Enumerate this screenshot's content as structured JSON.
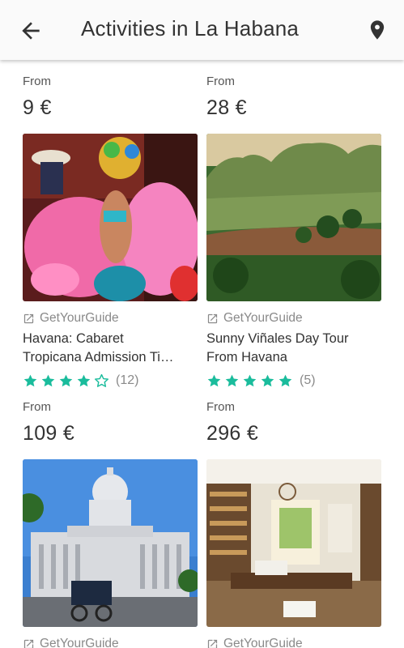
{
  "header": {
    "title": "Activities in La Habana",
    "back_icon": "arrow-back-icon",
    "location_icon": "location-pin-icon"
  },
  "colors": {
    "accent": "#1ABC9C",
    "text": "#333333",
    "muted": "#8A8A8A"
  },
  "activities": [
    {
      "from_label": "From",
      "price": "9 €",
      "provider": "GetYourGuide",
      "name_line1": "Havana: Cabaret",
      "name_line2": "Tropicana Admission Ti…",
      "stars": 4,
      "reviews": "(12)"
    },
    {
      "from_label": "From",
      "price": "28 €",
      "provider": "GetYourGuide",
      "name_line1": "Sunny Viñales Day Tour",
      "name_line2": "From Havana",
      "stars": 5,
      "reviews": "(5)"
    },
    {
      "from_label": "From",
      "price": "109 €",
      "provider": "GetYourGuide"
    },
    {
      "from_label": "From",
      "price": "296 €",
      "provider": "GetYourGuide"
    }
  ]
}
